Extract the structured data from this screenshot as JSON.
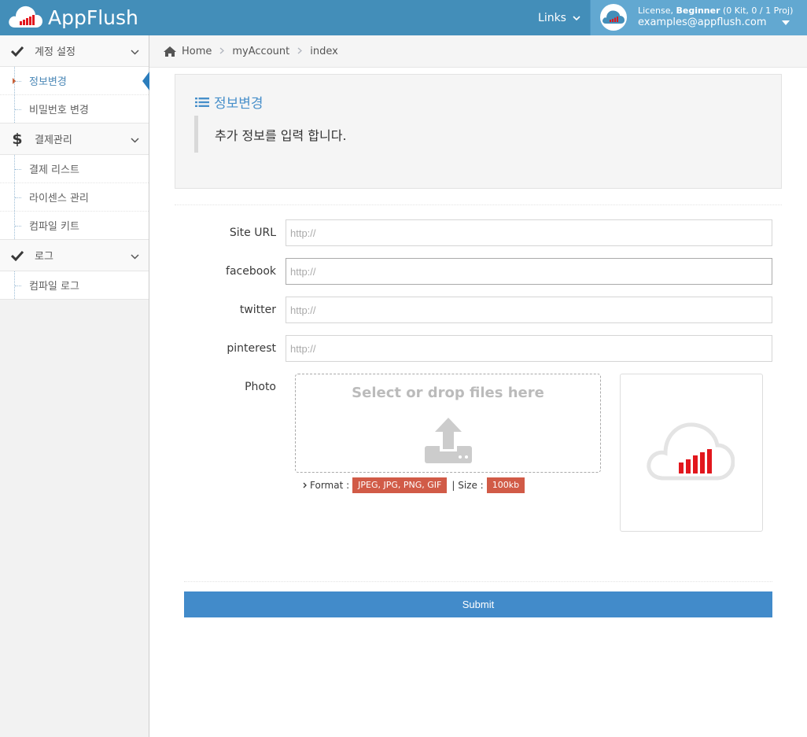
{
  "header": {
    "brand": "AppFlush",
    "links_label": "Links",
    "license_prefix": "License, ",
    "license_plan": "Beginner",
    "license_detail": " (0 Kit, 0 / 1 Proj)",
    "user_email": "examples@appflush.com",
    "colors": {
      "navbar": "#438eb9",
      "user_box": "#62a8d1"
    }
  },
  "sidebar": {
    "groups": [
      {
        "label": "계정 설정",
        "icon": "check-icon",
        "items": [
          {
            "label": "정보변경",
            "active": true
          },
          {
            "label": "비밀번호 변경",
            "active": false
          }
        ]
      },
      {
        "label": "결제관리",
        "icon": "dollar-icon",
        "items": [
          {
            "label": "결제 리스트",
            "active": false
          },
          {
            "label": "라이센스 관리",
            "active": false
          },
          {
            "label": "컴파일 키트",
            "active": false
          }
        ]
      },
      {
        "label": "로그",
        "icon": "check-icon",
        "items": [
          {
            "label": "컴파일 로그",
            "active": false
          }
        ]
      }
    ]
  },
  "breadcrumb": {
    "home": "Home",
    "account": "myAccount",
    "current": "index"
  },
  "well": {
    "title": "정보변경",
    "description": "추가 정보를 입력 합니다."
  },
  "form": {
    "site_url": {
      "label": "Site URL",
      "placeholder": "http://",
      "value": ""
    },
    "facebook": {
      "label": "facebook",
      "placeholder": "http://",
      "value": ""
    },
    "twitter": {
      "label": "twitter",
      "placeholder": "http://",
      "value": ""
    },
    "pinterest": {
      "label": "pinterest",
      "placeholder": "http://",
      "value": ""
    },
    "photo_label": "Photo",
    "dropzone_text": "Select or drop files here",
    "format_prefix": "Format :",
    "format_value": "JPEG, JPG, PNG, GIF",
    "size_prefix": "| Size :",
    "size_value": "100kb",
    "submit_label": "Submit"
  },
  "colors": {
    "accent": "#438eb9",
    "submit": "#428bca",
    "badge": "#d15b47",
    "cloud_bars": "#e2171d"
  }
}
